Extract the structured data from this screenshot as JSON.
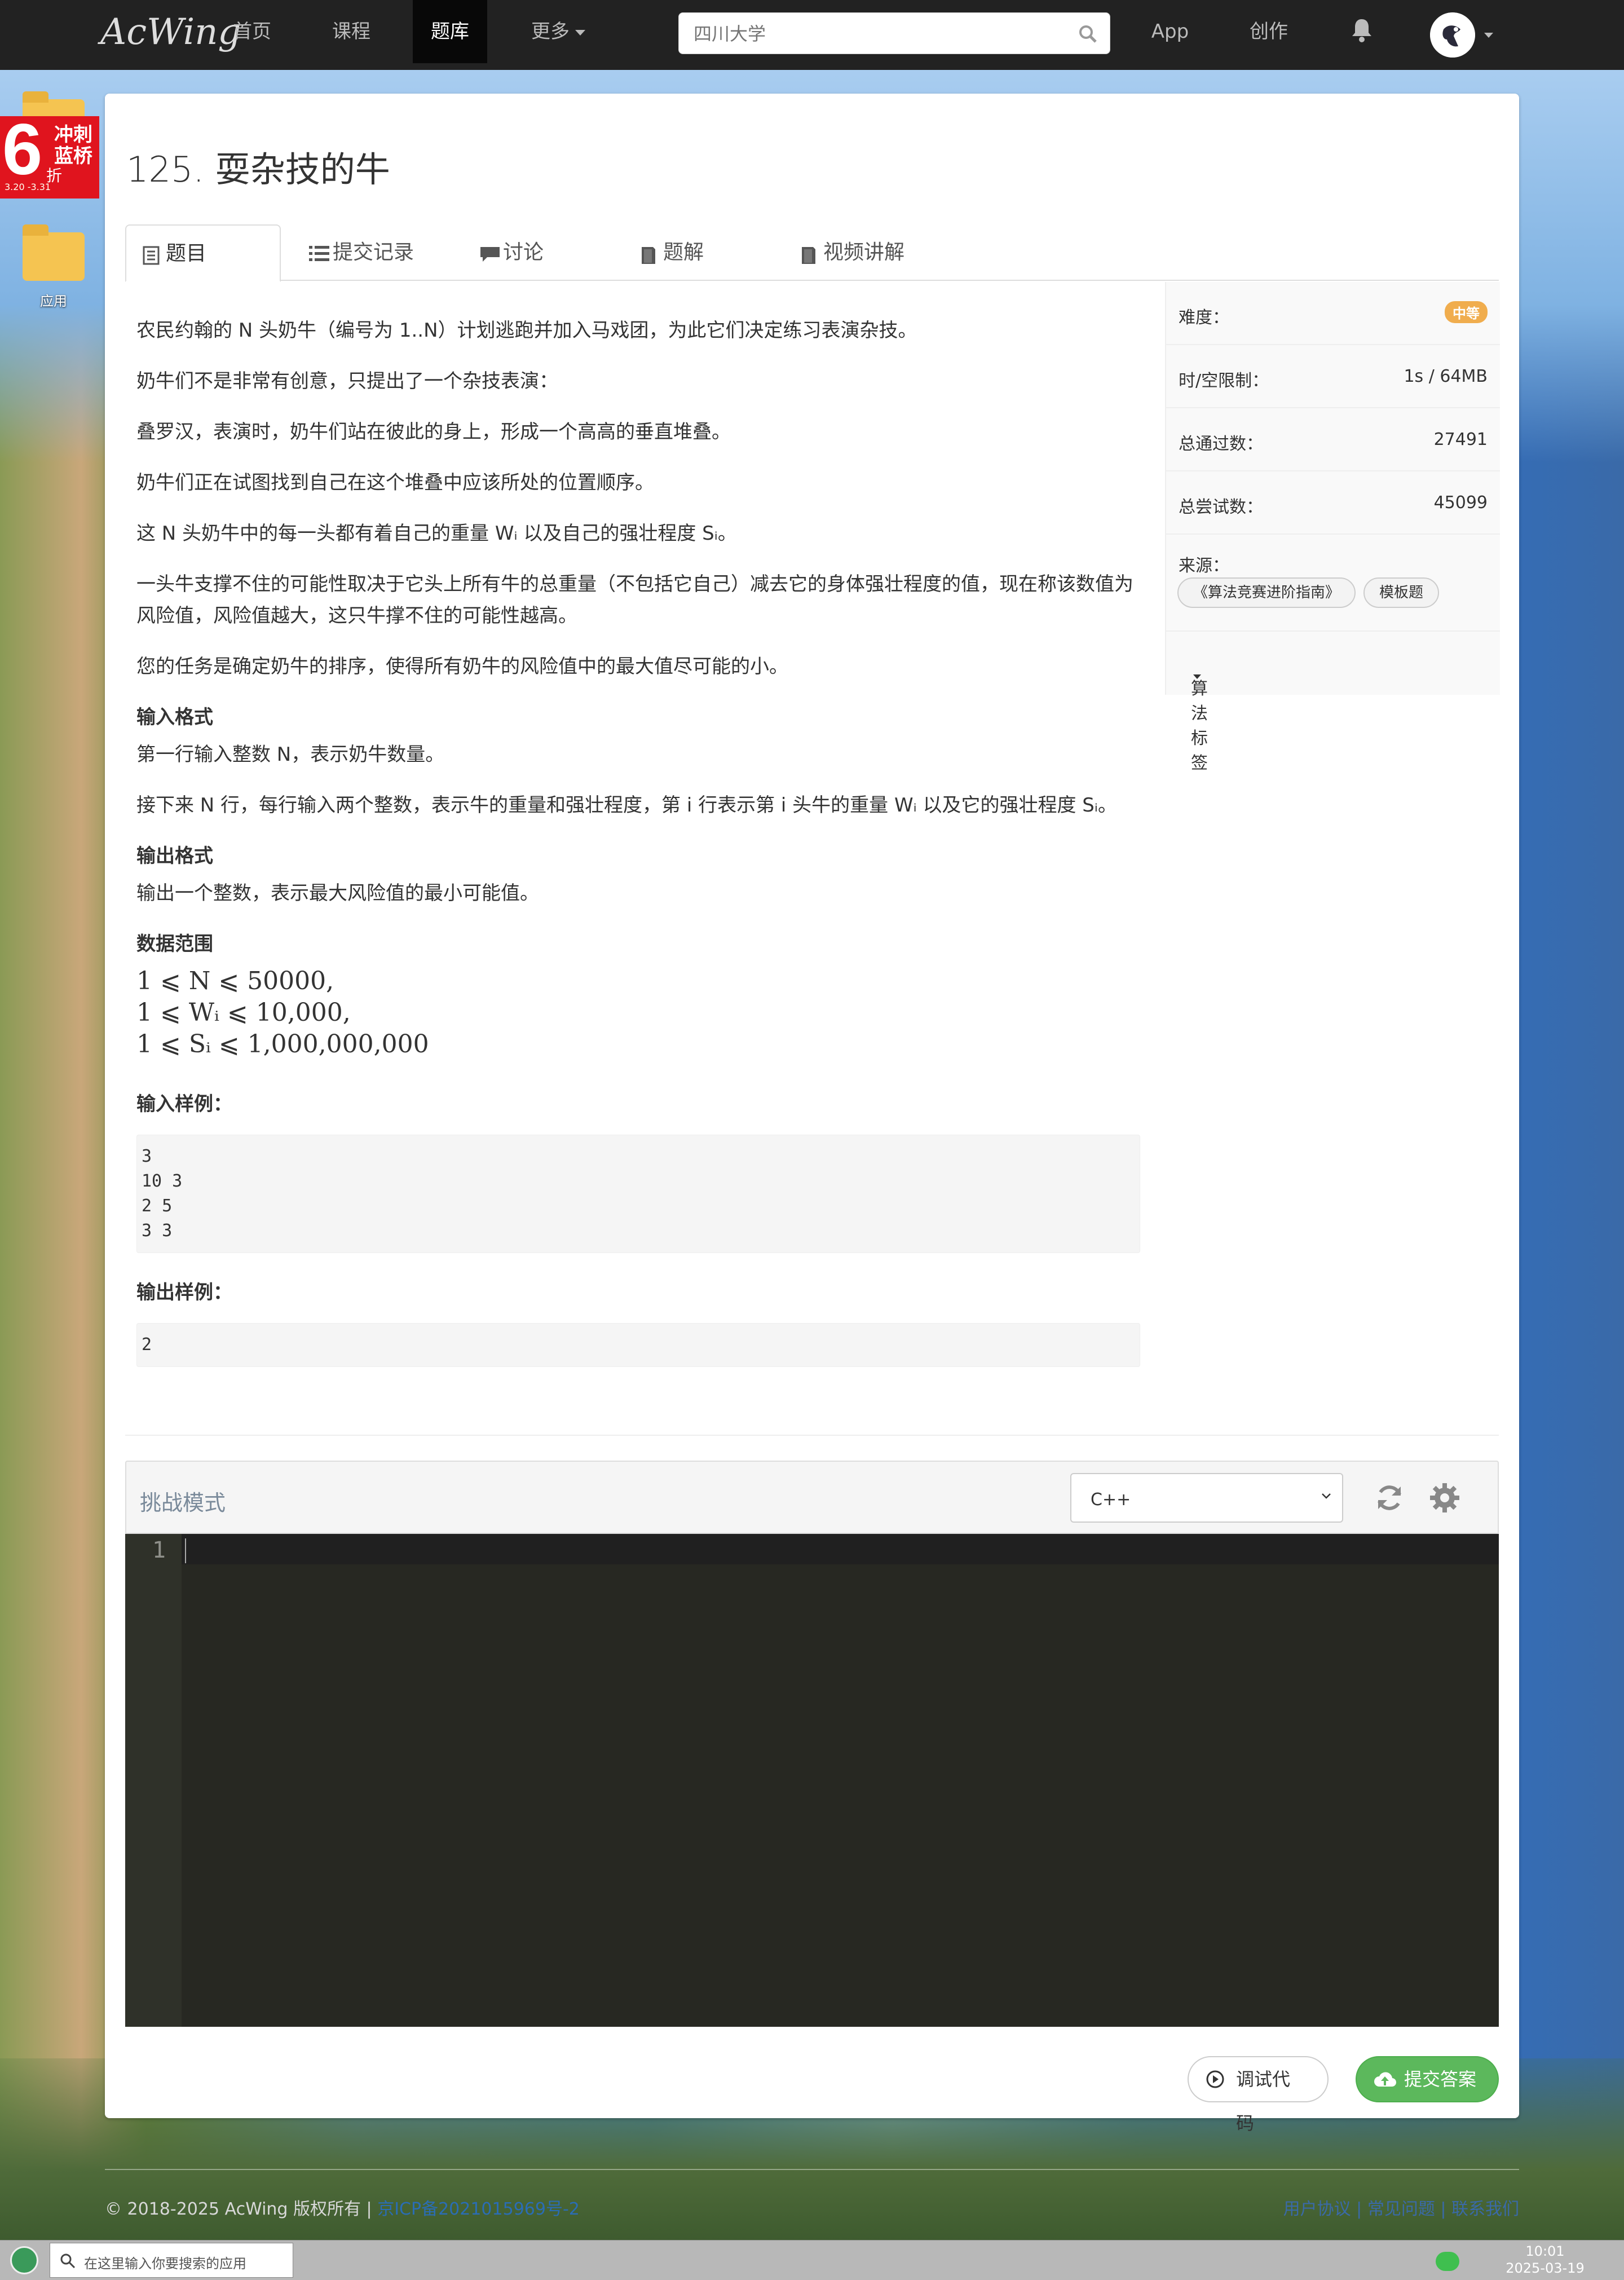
{
  "nav": {
    "logo": "AcWing",
    "items": [
      "首页",
      "课程",
      "题库",
      "更多"
    ],
    "search_placeholder": "四川大学",
    "app": "App",
    "create": "创作"
  },
  "desktop": {
    "promo": {
      "big": "6",
      "line1": "冲刺",
      "line2": "蓝桥",
      "line3": "折",
      "dates": "3.20  -3.31"
    },
    "folder_label": "应用"
  },
  "problem": {
    "title": "125. 耍杂技的牛",
    "tabs": [
      "题目",
      "提交记录",
      "讨论",
      "题解",
      "视频讲解"
    ],
    "paragraphs": [
      "农民约翰的 N 头奶牛（编号为 1..N）计划逃跑并加入马戏团，为此它们决定练习表演杂技。",
      "奶牛们不是非常有创意，只提出了一个杂技表演：",
      "叠罗汉，表演时，奶牛们站在彼此的身上，形成一个高高的垂直堆叠。",
      "奶牛们正在试图找到自己在这个堆叠中应该所处的位置顺序。",
      "这 N 头奶牛中的每一头都有着自己的重量 Wᵢ 以及自己的强壮程度 Sᵢ。",
      "一头牛支撑不住的可能性取决于它头上所有牛的总重量（不包括它自己）减去它的身体强壮程度的值，现在称该数值为风险值，风险值越大，这只牛撑不住的可能性越高。",
      "您的任务是确定奶牛的排序，使得所有奶牛的风险值中的最大值尽可能的小。"
    ],
    "input_heading": "输入格式",
    "input_lines": [
      "第一行输入整数 N，表示奶牛数量。",
      "接下来 N 行，每行输入两个整数，表示牛的重量和强壮程度，第 i 行表示第 i 头牛的重量 Wᵢ 以及它的强壮程度 Sᵢ。"
    ],
    "output_heading": "输出格式",
    "output_line": "输出一个整数，表示最大风险值的最小可能值。",
    "range_heading": "数据范围",
    "range_lines": [
      "1 ⩽ N ⩽ 50000,",
      "1 ⩽ Wᵢ ⩽ 10,000,",
      "1 ⩽ Sᵢ ⩽ 1,000,000,000"
    ],
    "sample_in_heading": "输入样例：",
    "sample_in": "3\n10 3\n2 5\n3 3",
    "sample_out_heading": "输出样例：",
    "sample_out": "2"
  },
  "side": {
    "difficulty_label": "难度：",
    "difficulty": "中等",
    "limit_label": "时/空限制：",
    "limit": "1s / 64MB",
    "passed_label": "总通过数：",
    "passed": "27491",
    "tried_label": "总尝试数：",
    "tried": "45099",
    "source_label": "来源：",
    "sources": [
      "《算法竞赛进阶指南》",
      "模板题"
    ],
    "algo_label": "算法标签"
  },
  "editor": {
    "mode": "挑战模式",
    "language": "C++",
    "line_number": "1",
    "debug_btn": "调试代码",
    "submit_btn": "提交答案"
  },
  "footer": {
    "copyright": "© 2018-2025 AcWing 版权所有  |  ",
    "icp": "京ICP备2021015969号-2",
    "links": "用户协议 | 常见问题 | 联系我们"
  },
  "taskbar": {
    "search_placeholder": "在这里输入你要搜索的应用",
    "time": "10:01",
    "date": "2025-03-19"
  }
}
